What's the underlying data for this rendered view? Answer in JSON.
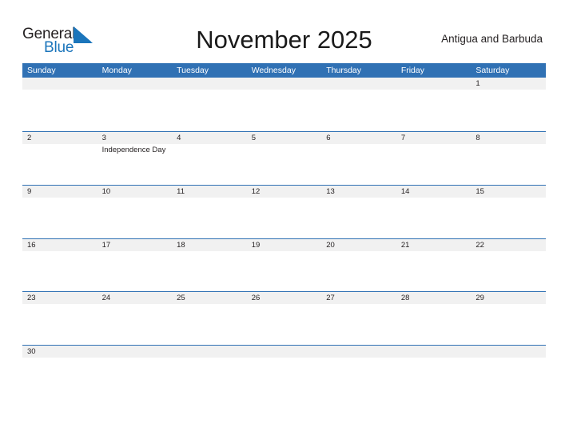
{
  "brand": {
    "logo_text_primary": "General",
    "logo_text_secondary": "Blue",
    "logo_icon": "blue-flag-triangle",
    "primary_color": "#1b75bb",
    "header_color": "#3071b4",
    "band_color": "#f1f1f1"
  },
  "header": {
    "title": "November 2025",
    "region": "Antigua and Barbuda"
  },
  "calendar": {
    "weekday_headers": [
      "Sunday",
      "Monday",
      "Tuesday",
      "Wednesday",
      "Thursday",
      "Friday",
      "Saturday"
    ],
    "weeks": [
      [
        {
          "day": "",
          "events": []
        },
        {
          "day": "",
          "events": []
        },
        {
          "day": "",
          "events": []
        },
        {
          "day": "",
          "events": []
        },
        {
          "day": "",
          "events": []
        },
        {
          "day": "",
          "events": []
        },
        {
          "day": "1",
          "events": []
        }
      ],
      [
        {
          "day": "2",
          "events": []
        },
        {
          "day": "3",
          "events": [
            "Independence Day"
          ]
        },
        {
          "day": "4",
          "events": []
        },
        {
          "day": "5",
          "events": []
        },
        {
          "day": "6",
          "events": []
        },
        {
          "day": "7",
          "events": []
        },
        {
          "day": "8",
          "events": []
        }
      ],
      [
        {
          "day": "9",
          "events": []
        },
        {
          "day": "10",
          "events": []
        },
        {
          "day": "11",
          "events": []
        },
        {
          "day": "12",
          "events": []
        },
        {
          "day": "13",
          "events": []
        },
        {
          "day": "14",
          "events": []
        },
        {
          "day": "15",
          "events": []
        }
      ],
      [
        {
          "day": "16",
          "events": []
        },
        {
          "day": "17",
          "events": []
        },
        {
          "day": "18",
          "events": []
        },
        {
          "day": "19",
          "events": []
        },
        {
          "day": "20",
          "events": []
        },
        {
          "day": "21",
          "events": []
        },
        {
          "day": "22",
          "events": []
        }
      ],
      [
        {
          "day": "23",
          "events": []
        },
        {
          "day": "24",
          "events": []
        },
        {
          "day": "25",
          "events": []
        },
        {
          "day": "26",
          "events": []
        },
        {
          "day": "27",
          "events": []
        },
        {
          "day": "28",
          "events": []
        },
        {
          "day": "29",
          "events": []
        }
      ],
      [
        {
          "day": "30",
          "events": []
        },
        {
          "day": "",
          "events": []
        },
        {
          "day": "",
          "events": []
        },
        {
          "day": "",
          "events": []
        },
        {
          "day": "",
          "events": []
        },
        {
          "day": "",
          "events": []
        },
        {
          "day": "",
          "events": []
        }
      ]
    ]
  }
}
